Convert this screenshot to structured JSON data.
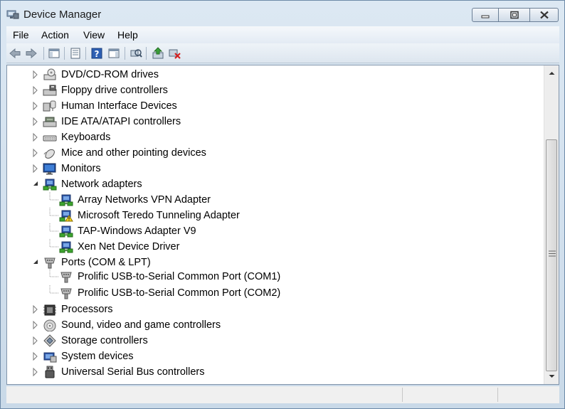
{
  "window": {
    "title": "Device Manager"
  },
  "menu": {
    "items": [
      "File",
      "Action",
      "View",
      "Help"
    ]
  },
  "toolbar": {
    "icons": [
      "back-arrow-icon",
      "forward-arrow-icon",
      "show-hide-console-tree-icon",
      "properties-icon",
      "help-icon",
      "action-pane-icon",
      "scan-hardware-icon",
      "update-driver-icon",
      "uninstall-device-icon"
    ]
  },
  "tree": [
    {
      "label": "DVD/CD-ROM drives",
      "level": 0,
      "expanded": false,
      "icon": "dvd-drive-icon"
    },
    {
      "label": "Floppy drive controllers",
      "level": 0,
      "expanded": false,
      "icon": "floppy-controller-icon"
    },
    {
      "label": "Human Interface Devices",
      "level": 0,
      "expanded": false,
      "icon": "hid-icon"
    },
    {
      "label": "IDE ATA/ATAPI controllers",
      "level": 0,
      "expanded": false,
      "icon": "ide-controller-icon"
    },
    {
      "label": "Keyboards",
      "level": 0,
      "expanded": false,
      "icon": "keyboard-icon"
    },
    {
      "label": "Mice and other pointing devices",
      "level": 0,
      "expanded": false,
      "icon": "mouse-icon"
    },
    {
      "label": "Monitors",
      "level": 0,
      "expanded": false,
      "icon": "monitor-icon"
    },
    {
      "label": "Network adapters",
      "level": 0,
      "expanded": true,
      "icon": "network-adapter-icon"
    },
    {
      "label": "Array Networks VPN Adapter",
      "level": 1,
      "icon": "network-adapter-icon"
    },
    {
      "label": "Microsoft Teredo Tunneling Adapter",
      "level": 1,
      "icon": "network-adapter-warning-icon"
    },
    {
      "label": "TAP-Windows Adapter V9",
      "level": 1,
      "icon": "network-adapter-icon"
    },
    {
      "label": "Xen Net Device Driver",
      "level": 1,
      "icon": "network-adapter-icon"
    },
    {
      "label": "Ports (COM & LPT)",
      "level": 0,
      "expanded": true,
      "icon": "port-icon"
    },
    {
      "label": "Prolific USB-to-Serial Common Port (COM1)",
      "level": 1,
      "icon": "port-icon"
    },
    {
      "label": "Prolific USB-to-Serial Common Port (COM2)",
      "level": 1,
      "icon": "port-icon"
    },
    {
      "label": "Processors",
      "level": 0,
      "expanded": false,
      "icon": "processor-icon"
    },
    {
      "label": "Sound, video and game controllers",
      "level": 0,
      "expanded": false,
      "icon": "sound-icon"
    },
    {
      "label": "Storage controllers",
      "level": 0,
      "expanded": false,
      "icon": "storage-controller-icon"
    },
    {
      "label": "System devices",
      "level": 0,
      "expanded": false,
      "icon": "system-devices-icon"
    },
    {
      "label": "Universal Serial Bus controllers",
      "level": 0,
      "expanded": false,
      "icon": "usb-icon"
    }
  ],
  "colors": {
    "frame": "#c9d9e8",
    "tree_background": "#ffffff",
    "network_green": "#3da52f",
    "port_gray": "#8a8a8a"
  }
}
